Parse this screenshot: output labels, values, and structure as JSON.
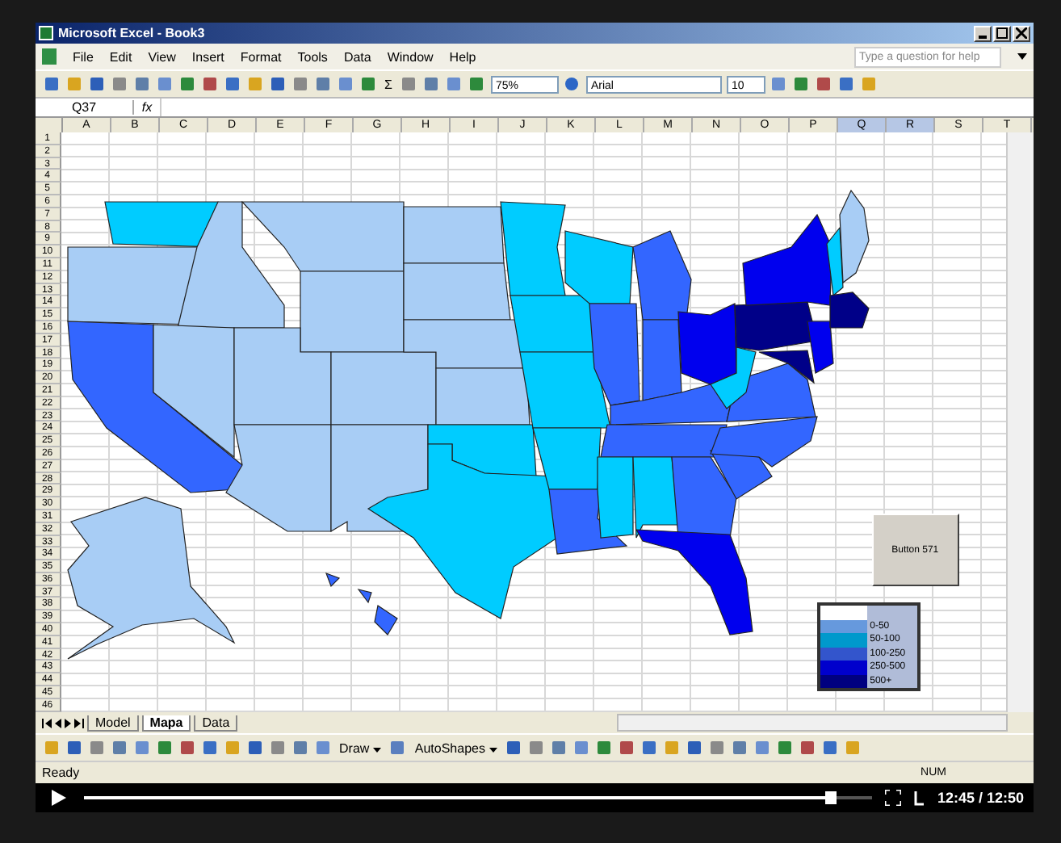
{
  "window": {
    "title": "Microsoft Excel - Book3"
  },
  "menu": [
    "File",
    "Edit",
    "View",
    "Insert",
    "Format",
    "Tools",
    "Data",
    "Window",
    "Help"
  ],
  "help_box": {
    "placeholder": "Type a question for help"
  },
  "toolbar": {
    "sum": "Σ",
    "zoom": "75%",
    "font": "Arial",
    "size": "10"
  },
  "formula_bar": {
    "name_box": "Q37",
    "fx": "fx"
  },
  "columns": [
    {
      "label": "A",
      "selected": false
    },
    {
      "label": "B",
      "selected": false
    },
    {
      "label": "C",
      "selected": false
    },
    {
      "label": "D",
      "selected": false
    },
    {
      "label": "E",
      "selected": false
    },
    {
      "label": "F",
      "selected": false
    },
    {
      "label": "G",
      "selected": false
    },
    {
      "label": "H",
      "selected": false
    },
    {
      "label": "I",
      "selected": false
    },
    {
      "label": "J",
      "selected": false
    },
    {
      "label": "K",
      "selected": false
    },
    {
      "label": "L",
      "selected": false
    },
    {
      "label": "M",
      "selected": false
    },
    {
      "label": "N",
      "selected": false
    },
    {
      "label": "O",
      "selected": false
    },
    {
      "label": "P",
      "selected": false
    },
    {
      "label": "Q",
      "selected": true
    },
    {
      "label": "R",
      "selected": true
    },
    {
      "label": "S",
      "selected": false
    },
    {
      "label": "T",
      "selected": false
    }
  ],
  "rows": [
    "1",
    "2",
    "3",
    "4",
    "5",
    "6",
    "7",
    "8",
    "9",
    "10",
    "11",
    "12",
    "13",
    "14",
    "15",
    "16",
    "17",
    "18",
    "19",
    "20",
    "21",
    "22",
    "23",
    "24",
    "25",
    "26",
    "27",
    "28",
    "29",
    "30",
    "31",
    "32",
    "33",
    "34",
    "35",
    "36",
    "37",
    "38",
    "39",
    "40",
    "41",
    "42",
    "43",
    "44",
    "45",
    "46"
  ],
  "button": "Button 571",
  "legend": [
    {
      "label": "0-50",
      "color": "#6699dd"
    },
    {
      "label": "50-100",
      "color": "#0099cc"
    },
    {
      "label": "100-250",
      "color": "#3355cc"
    },
    {
      "label": "250-500",
      "color": "#0000cc"
    },
    {
      "label": "500+",
      "color": "#000080"
    }
  ],
  "sheet_tabs": [
    {
      "label": "Model",
      "selected": false
    },
    {
      "label": "Mapa",
      "selected": true
    },
    {
      "label": "Data",
      "selected": false
    }
  ],
  "drawing_toolbar": {
    "draw": "Draw",
    "autoshapes": "AutoShapes"
  },
  "status_bar": {
    "state": "Ready",
    "num": "NUM"
  },
  "player": {
    "level": 0.94,
    "time": "12:45 / 12:50"
  }
}
